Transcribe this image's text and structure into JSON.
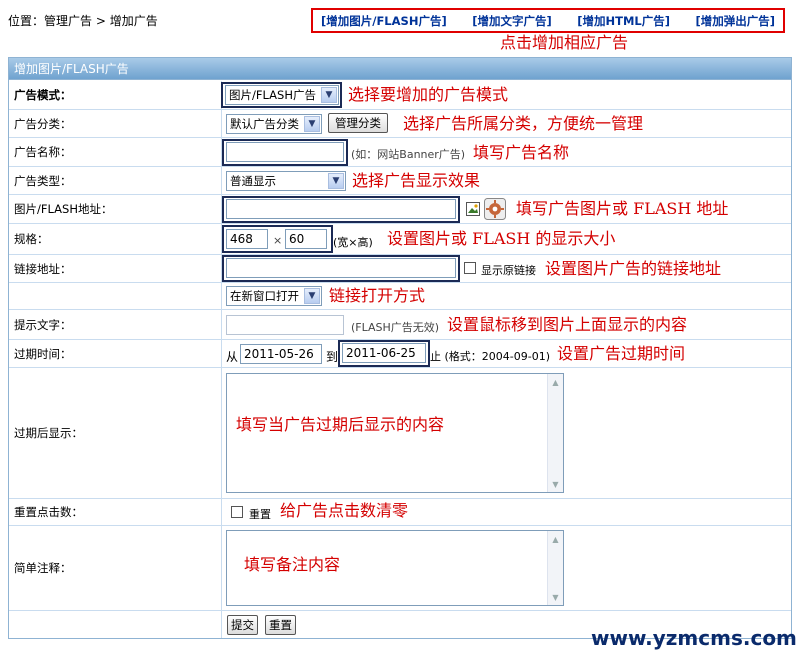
{
  "breadcrumb": {
    "prefix": "位置：",
    "manage": "管理广告",
    "sep": " > ",
    "current": "增加广告"
  },
  "topnav": {
    "items": [
      "[增加图片/FLASH广告]",
      "[增加文字广告]",
      "[增加HTML广告]",
      "[增加弹出广告]"
    ],
    "annotation": "点击增加相应广告"
  },
  "panel": {
    "title": "增加图片/FLASH广告"
  },
  "form": {
    "mode": {
      "label": "广告模式：",
      "value": "图片/FLASH广告",
      "annotation": "选择要增加的广告模式"
    },
    "category": {
      "label": "广告分类：",
      "value": "默认广告分类",
      "button": "管理分类",
      "annotation": "选择广告所属分类，方便统一管理"
    },
    "name": {
      "label": "广告名称：",
      "value": "",
      "note": "(如：网站Banner广告)",
      "annotation": "填写广告名称"
    },
    "type": {
      "label": "广告类型：",
      "value": "普通显示",
      "annotation": "选择广告显示效果"
    },
    "url": {
      "label": "图片/FLASH地址：",
      "value": "",
      "annotation": "填写广告图片或 FLASH 地址"
    },
    "size": {
      "label": "规格：",
      "width": "468",
      "times": "×",
      "height": "60",
      "note": "(宽×高)",
      "annotation": "设置图片或 FLASH 的显示大小"
    },
    "link": {
      "label": "链接地址：",
      "value": "",
      "checkbox_label": "显示原链接",
      "annotation": "设置图片广告的链接地址"
    },
    "target": {
      "value": "在新窗口打开",
      "annotation": "链接打开方式"
    },
    "tip": {
      "label": "提示文字：",
      "value": "",
      "note": "(FLASH广告无效)",
      "annotation": "设置鼠标移到图片上面显示的内容"
    },
    "expire": {
      "label": "过期时间：",
      "from_label": "从",
      "from": "2011-05-26",
      "to_label": "到",
      "to": "2011-06-25",
      "format_note": "止 (格式：2004-09-01)",
      "annotation": "设置广告过期时间"
    },
    "expired_show": {
      "label": "过期后显示：",
      "annotation": "填写当广告过期后显示的内容"
    },
    "reset_clicks": {
      "label": "重置点击数：",
      "checkbox_label": "重置",
      "annotation": "给广告点击数清零"
    },
    "remark": {
      "label": "简单注释：",
      "annotation": "填写备注内容"
    },
    "submit": "提交",
    "reset": "重置"
  },
  "watermark": "www.yzmcms.com",
  "colors": {
    "annotation": "#d40000",
    "nav": "#003399",
    "header": "#7aaed6",
    "highlight_box": "#1b2a55"
  }
}
